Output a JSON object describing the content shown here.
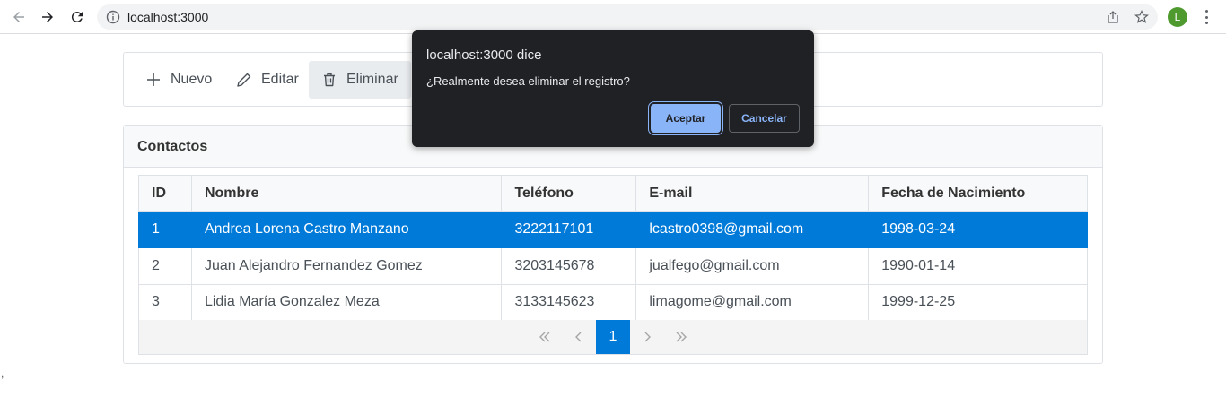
{
  "browser": {
    "url": "localhost:3000",
    "avatar_letter": "L",
    "avatar_color": "#4e9a2e"
  },
  "toolbar": {
    "new_label": "Nuevo",
    "edit_label": "Editar",
    "delete_label": "Eliminar"
  },
  "panel": {
    "title": "Contactos"
  },
  "table": {
    "headers": [
      "ID",
      "Nombre",
      "Teléfono",
      "E-mail",
      "Fecha de Nacimiento"
    ],
    "rows": [
      [
        "1",
        "Andrea Lorena Castro Manzano",
        "3222117101",
        "lcastro0398@gmail.com",
        "1998-03-24"
      ],
      [
        "2",
        "Juan Alejandro Fernandez Gomez",
        "3203145678",
        "jualfego@gmail.com",
        "1990-01-14"
      ],
      [
        "3",
        "Lidia María Gonzalez Meza",
        "3133145623",
        "limagome@gmail.com",
        "1999-12-25"
      ]
    ],
    "selected_row": 0
  },
  "paginator": {
    "current_page": "1"
  },
  "dialog": {
    "title": "localhost:3000 dice",
    "message": "¿Realmente desea eliminar el registro?",
    "ok_label": "Aceptar",
    "cancel_label": "Cancelar"
  },
  "stray_text": ",",
  "colors": {
    "accent": "#007ad9",
    "dialog_bg": "#202124",
    "dialog_button": "#8ab4f8"
  }
}
